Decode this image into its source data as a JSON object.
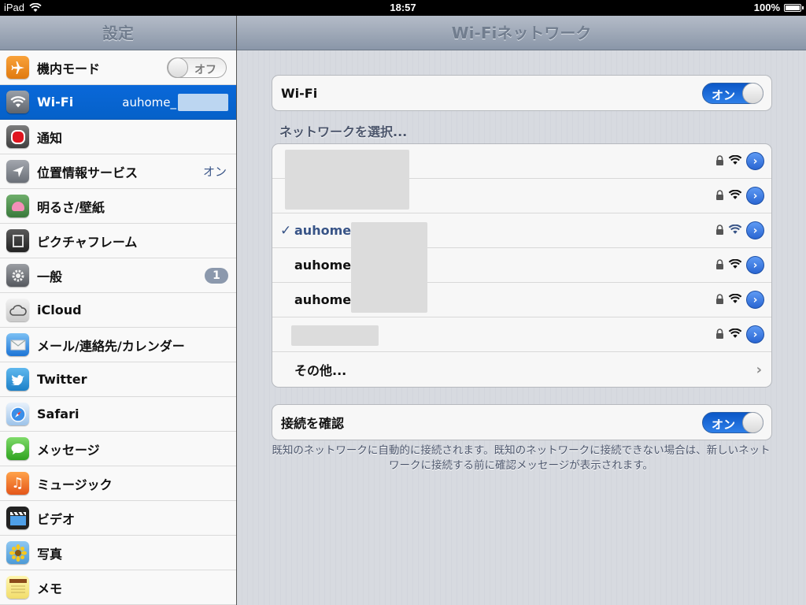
{
  "status_bar": {
    "device": "iPad",
    "time": "18:57",
    "battery": "100%",
    "battery_level": 1.0
  },
  "master": {
    "title": "設定",
    "items": [
      {
        "label": "機内モード",
        "icon": "airplane-icon",
        "toggle_label": "オフ"
      },
      {
        "label": "Wi-Fi",
        "icon": "wifi-icon",
        "value": "auhome_",
        "selected": true
      },
      {
        "label": "通知",
        "icon": "notifications-icon"
      },
      {
        "label": "位置情報サービス",
        "icon": "location-icon",
        "value": "オン"
      },
      {
        "label": "明るさ/壁紙",
        "icon": "brightness-wallpaper-icon"
      },
      {
        "label": "ピクチャフレーム",
        "icon": "picture-frame-icon"
      },
      {
        "label": "一般",
        "icon": "gear-icon",
        "badge": "1"
      },
      {
        "label": "iCloud",
        "icon": "icloud-icon"
      },
      {
        "label": "メール/連絡先/カレンダー",
        "icon": "mail-icon"
      },
      {
        "label": "Twitter",
        "icon": "twitter-icon"
      },
      {
        "label": "Safari",
        "icon": "safari-icon"
      },
      {
        "label": "メッセージ",
        "icon": "messages-icon"
      },
      {
        "label": "ミュージック",
        "icon": "music-icon"
      },
      {
        "label": "ビデオ",
        "icon": "video-icon"
      },
      {
        "label": "写真",
        "icon": "photos-icon"
      },
      {
        "label": "メモ",
        "icon": "notes-icon"
      }
    ]
  },
  "detail": {
    "title": "Wi-Fiネットワーク",
    "wifi_label": "Wi-Fi",
    "wifi_toggle": "オン",
    "networks_header": "ネットワークを選択...",
    "networks": [
      {
        "name": "",
        "connected": false
      },
      {
        "name": "",
        "connected": false
      },
      {
        "name": "auhome_",
        "connected": true
      },
      {
        "name": "auhome_",
        "connected": false
      },
      {
        "name": "auhome_",
        "connected": false
      },
      {
        "name": "",
        "connected": false
      }
    ],
    "other_label": "その他...",
    "ask_label": "接続を確認",
    "ask_toggle": "オン",
    "footer": "既知のネットワークに自動的に接続されます。既知のネットワークに接続できない場合は、新しいネットワークに接続する前に確認メッセージが表示されます。"
  },
  "colors": {
    "selected_blue": "#0a68d9",
    "toggle_on": "#1f6fe0",
    "value_blue": "#385487"
  }
}
